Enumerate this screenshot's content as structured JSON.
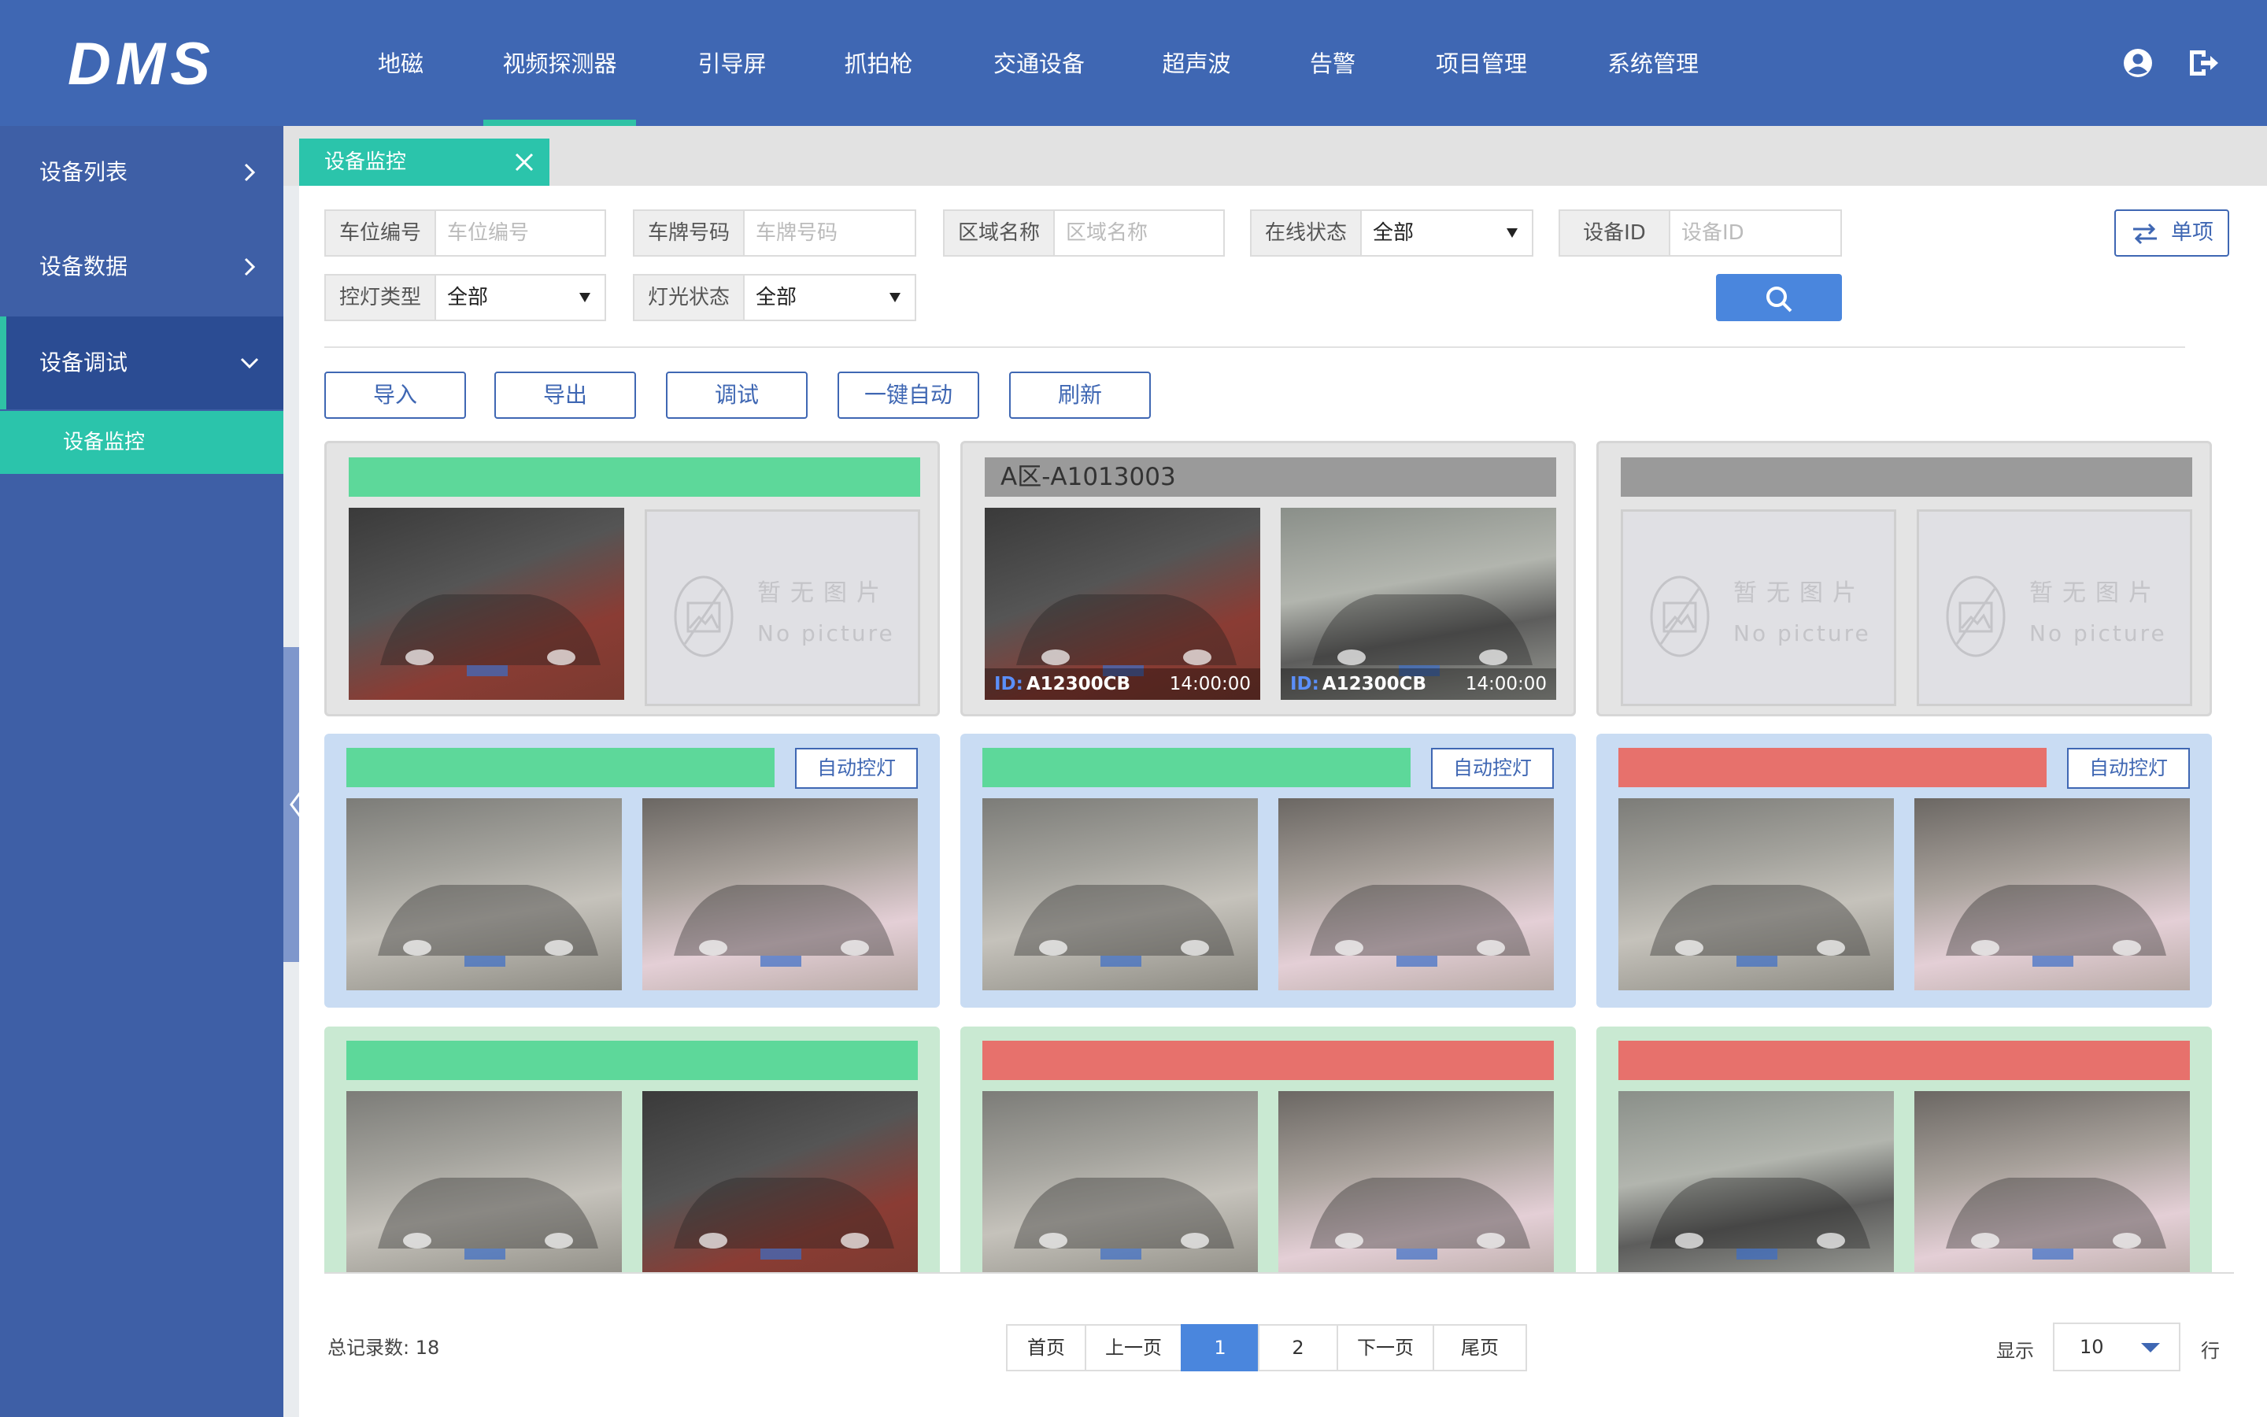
{
  "app": {
    "logo": "DMS"
  },
  "nav": [
    "地磁",
    "视频探测器",
    "引导屏",
    "抓拍枪",
    "交通设备",
    "超声波",
    "告警",
    "项目管理",
    "系统管理"
  ],
  "nav_active": "视频探测器",
  "sidebar": {
    "items": [
      {
        "label": "设备列表",
        "chevron": "right"
      },
      {
        "label": "设备数据",
        "chevron": "right"
      },
      {
        "label": "设备调试",
        "chevron": "down"
      }
    ],
    "sub_item": "设备监控"
  },
  "tab": {
    "label": "设备监控"
  },
  "filters": {
    "space_no": {
      "label": "车位编号",
      "placeholder": "车位编号"
    },
    "plate_no": {
      "label": "车牌号码",
      "placeholder": "车牌号码"
    },
    "area": {
      "label": "区域名称",
      "placeholder": "区域名称"
    },
    "online": {
      "label": "在线状态",
      "value": "全部"
    },
    "device_id": {
      "label": "设备ID",
      "placeholder": "设备ID"
    },
    "light_type": {
      "label": "控灯类型",
      "value": "全部"
    },
    "light_state": {
      "label": "灯光状态",
      "value": "全部"
    }
  },
  "single_button": "单项",
  "actions": [
    "导入",
    "导出",
    "调试",
    "一键自动",
    "刷新"
  ],
  "cards": [
    {
      "style": "gray",
      "bar_color": "#5dd89a",
      "bar_text": "",
      "auto_btn": "",
      "photos": [
        "dark",
        "nopic"
      ]
    },
    {
      "style": "gray",
      "bar_color": "#9a9a9a",
      "bar_text": "A区-A1013003",
      "auto_btn": "",
      "photos": [
        "dark",
        "garage"
      ],
      "captions": [
        {
          "id_label": "ID:",
          "id": "A12300CB",
          "time": "14:00:00"
        },
        {
          "id_label": "ID:",
          "id": "A12300CB",
          "time": "14:00:00"
        }
      ]
    },
    {
      "style": "gray",
      "bar_color": "#9a9a9a",
      "bar_text": "",
      "auto_btn": "",
      "photos": [
        "nopic",
        "nopic"
      ]
    },
    {
      "style": "blue",
      "bar_color": "#5dd89a",
      "bar_text": "",
      "auto_btn": "自动控灯",
      "photos": [
        "light",
        "pink"
      ]
    },
    {
      "style": "blue",
      "bar_color": "#5dd89a",
      "bar_text": "",
      "auto_btn": "自动控灯",
      "photos": [
        "light",
        "pink"
      ]
    },
    {
      "style": "blue",
      "bar_color": "#e7716c",
      "bar_text": "",
      "auto_btn": "自动控灯",
      "photos": [
        "light",
        "pink"
      ]
    },
    {
      "style": "green",
      "bar_color": "#5dd89a",
      "bar_text": "",
      "auto_btn": "",
      "photos": [
        "light",
        "dark"
      ]
    },
    {
      "style": "green",
      "bar_color": "#e7716c",
      "bar_text": "",
      "auto_btn": "",
      "photos": [
        "light",
        "pink"
      ]
    },
    {
      "style": "green",
      "bar_color": "#e7716c",
      "bar_text": "",
      "auto_btn": "",
      "photos": [
        "garage",
        "pink"
      ]
    }
  ],
  "no_picture": {
    "cn": "暂无图片",
    "en": "No picture"
  },
  "footer": {
    "total_label": "总记录数:",
    "total": "18",
    "pager": [
      "首页",
      "上一页",
      "1",
      "2",
      "下一页",
      "尾页"
    ],
    "current_page": "1",
    "show_label": "显示",
    "page_size": "10",
    "rows_label": "行"
  },
  "colors": {
    "primary": "#3f67b3",
    "accent": "#2bc4ab",
    "sidebar": "#3e5fa6"
  }
}
